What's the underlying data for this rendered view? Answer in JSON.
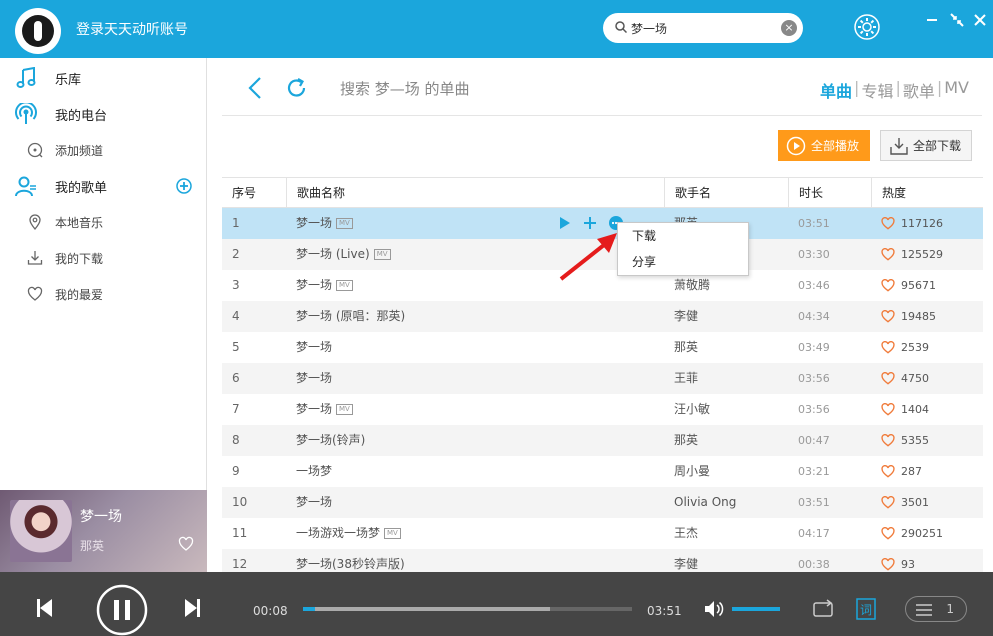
{
  "header": {
    "login_text": "登录天天动听账号",
    "search_value": "梦一场",
    "clear_glyph": "×",
    "brand_color": "#1ba6dc"
  },
  "sidebar": {
    "items": [
      {
        "label": "乐库",
        "icon": "music-note-icon"
      },
      {
        "label": "我的电台",
        "icon": "radio-icon"
      },
      {
        "label": "添加频道",
        "icon": "add-channel-icon"
      },
      {
        "label": "我的歌单",
        "icon": "user-playlist-icon"
      },
      {
        "label": "本地音乐",
        "icon": "location-pin-icon"
      },
      {
        "label": "我的下载",
        "icon": "download-icon"
      },
      {
        "label": "我的最爱",
        "icon": "heart-icon"
      }
    ]
  },
  "now_playing": {
    "title": "梦一场",
    "artist": "那英"
  },
  "main": {
    "search_title": "搜索 梦—场 的单曲",
    "tabs": [
      "单曲",
      "专辑",
      "歌单",
      "MV"
    ],
    "active_tab": "单曲",
    "play_all_label": "全部播放",
    "download_all_label": "全部下载",
    "accent_orange": "#ff9a1a"
  },
  "table": {
    "headers": [
      "序号",
      "歌曲名称",
      "歌手名",
      "时长",
      "热度"
    ],
    "rows": [
      {
        "num": "1",
        "title": "梦一场",
        "mv": true,
        "artist": "那英",
        "duration": "03:51",
        "hot": "117126"
      },
      {
        "num": "2",
        "title": "梦一场 (Live)",
        "mv": true,
        "artist": "",
        "duration": "03:30",
        "hot": "125529"
      },
      {
        "num": "3",
        "title": "梦一场",
        "mv": true,
        "artist": "萧敬腾",
        "duration": "03:46",
        "hot": "95671"
      },
      {
        "num": "4",
        "title": "梦一场 (原唱：那英)",
        "mv": false,
        "artist": "李健",
        "duration": "04:34",
        "hot": "19485"
      },
      {
        "num": "5",
        "title": "梦一场",
        "mv": false,
        "artist": "那英",
        "duration": "03:49",
        "hot": "2539"
      },
      {
        "num": "6",
        "title": "梦一场",
        "mv": false,
        "artist": "王菲",
        "duration": "03:56",
        "hot": "4750"
      },
      {
        "num": "7",
        "title": "梦一场",
        "mv": true,
        "artist": "汪小敏",
        "duration": "03:56",
        "hot": "1404"
      },
      {
        "num": "8",
        "title": "梦一场(铃声)",
        "mv": false,
        "artist": "那英",
        "duration": "00:47",
        "hot": "5355"
      },
      {
        "num": "9",
        "title": "一场梦",
        "mv": false,
        "artist": "周小曼",
        "duration": "03:21",
        "hot": "287"
      },
      {
        "num": "10",
        "title": "梦一场",
        "mv": false,
        "artist": "Olivia Ong",
        "duration": "03:51",
        "hot": "3501"
      },
      {
        "num": "11",
        "title": "一场游戏一场梦",
        "mv": true,
        "artist": "王杰",
        "duration": "04:17",
        "hot": "290251"
      },
      {
        "num": "12",
        "title": "梦一场(38秒铃声版)",
        "mv": false,
        "artist": "李健",
        "duration": "00:38",
        "hot": "93"
      }
    ],
    "mv_badge": "MV"
  },
  "context_menu": {
    "items": [
      "下载",
      "分享"
    ]
  },
  "player": {
    "current_time": "00:08",
    "total_time": "03:51",
    "progress_fraction": 0.035,
    "buffer_fraction": 0.75,
    "volume_fraction": 1.0,
    "queue_count": "1"
  }
}
